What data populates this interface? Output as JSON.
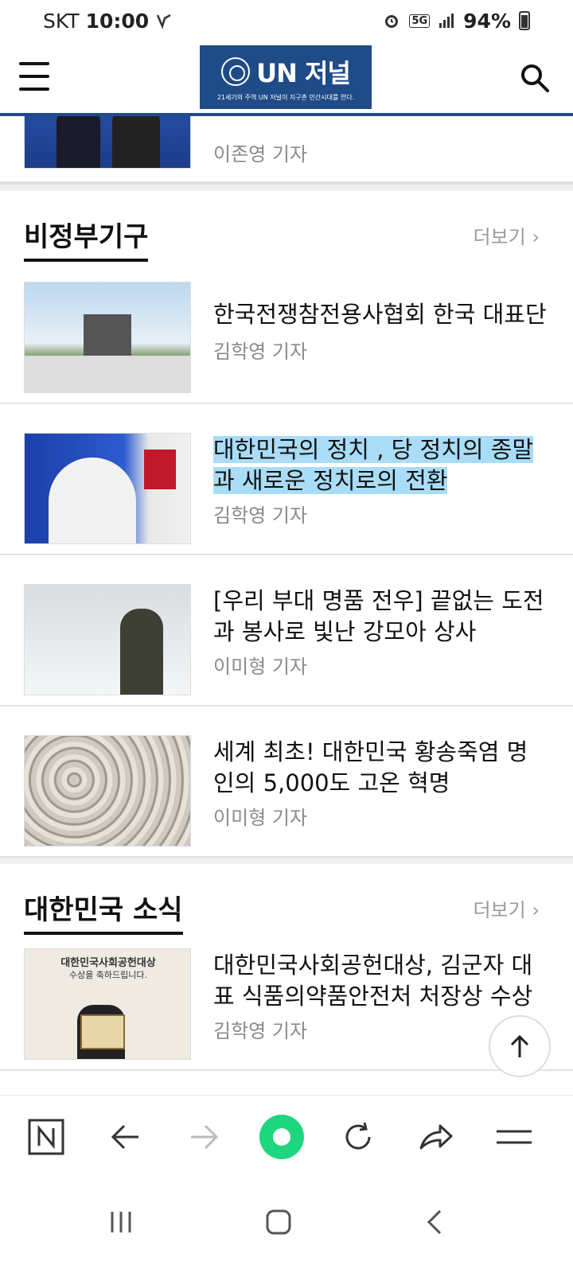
{
  "status": {
    "carrier": "SKT",
    "time": "10:00",
    "network": "5G",
    "battery": "94%"
  },
  "header": {
    "logo_name": "UN 저널",
    "logo_emblem": "UN",
    "logo_tagline": "21세기의 주역 UN 저널이 지구촌 민간시대를 연다."
  },
  "top_article": {
    "author": "이존영 기자"
  },
  "sections": [
    {
      "title": "비정부기구",
      "more": "더보기",
      "articles": [
        {
          "title": "한국전쟁참전용사협회 한국 대표단",
          "author": "김학영 기자"
        },
        {
          "title": "대한민국의 정치 , 당 정치의 종말과 새로운 정치로의 전환",
          "author": "김학영 기자"
        },
        {
          "title": "[우리 부대 명품 전우] 끝없는 도전과 봉사로 빛난 강모아 상사",
          "author": "이미형 기자"
        },
        {
          "title": "세계 최초! 대한민국 황송죽염 명인의 5,000도 고온 혁명",
          "author": "이미형 기자"
        }
      ]
    },
    {
      "title": "대한민국 소식",
      "more": "더보기",
      "articles": [
        {
          "title": "대한민국사회공헌대상, 김군자 대표 식품의약품안전처 처장상 수상",
          "author": "김학영 기자"
        }
      ]
    }
  ],
  "thumb_texts": {
    "award_banner_line1": "대한민국사회공헌대상",
    "award_banner_line2": "수상을 축하드립니다."
  },
  "icons": {
    "menu": "hamburger-icon",
    "search": "search-icon",
    "top": "arrow-up-icon",
    "browser": [
      "naver-n-icon",
      "back-arrow-icon",
      "forward-arrow-icon",
      "home-circle-icon",
      "refresh-icon",
      "share-icon",
      "menu-lines-icon"
    ],
    "nav": [
      "recent-apps-icon",
      "home-icon",
      "back-icon"
    ]
  },
  "colors": {
    "brand": "#1f4b87",
    "highlight": "#a9dcf7",
    "browser_accent": "#1ed67d"
  }
}
